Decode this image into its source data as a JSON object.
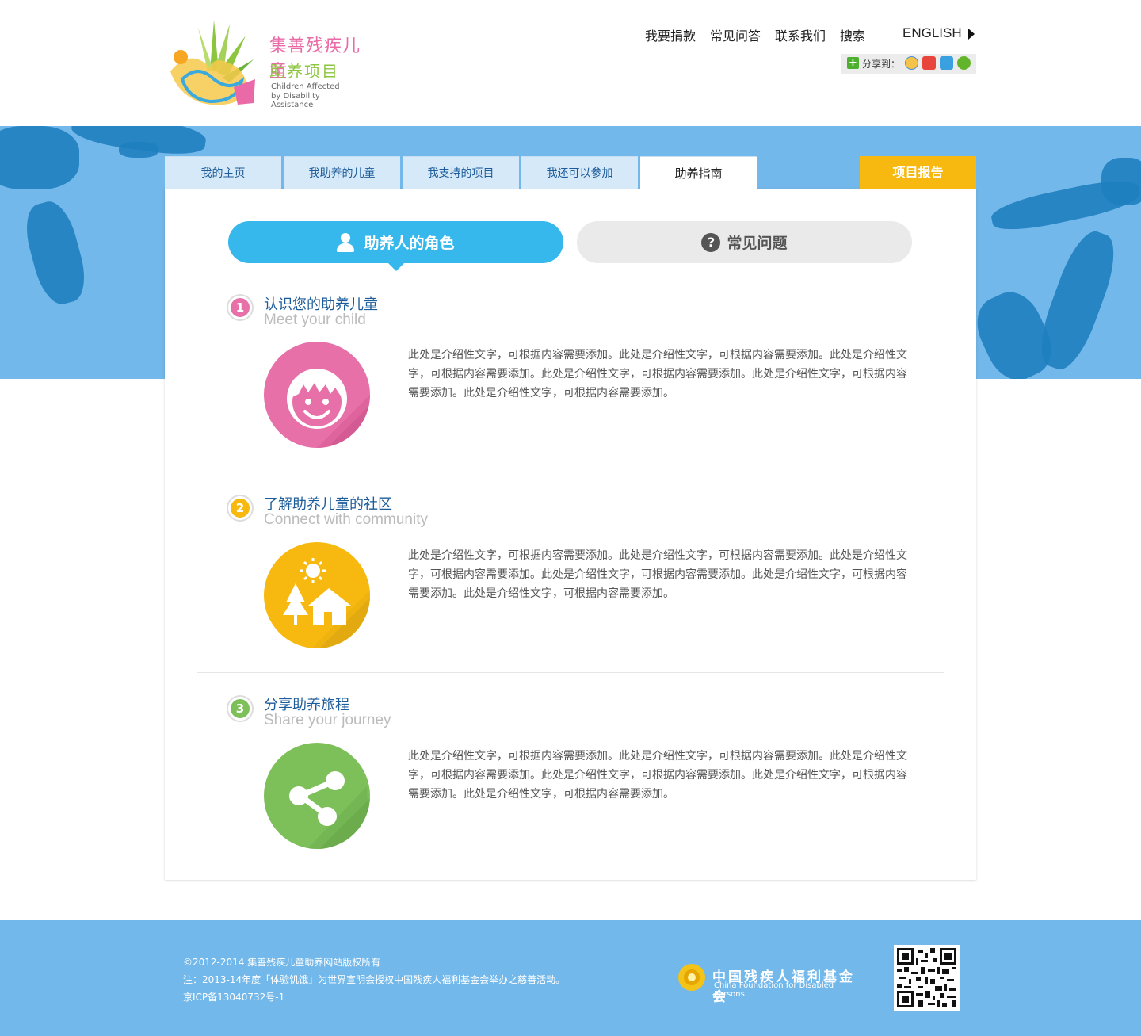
{
  "logo": {
    "cn_line1": "集善残疾儿童",
    "cn_line2": "助养项目",
    "en_line1": "Children Affected",
    "en_line2": "by Disability Assistance"
  },
  "topnav": {
    "items": [
      "我要捐款",
      "常见问答",
      "联系我们",
      "搜索"
    ],
    "english": "ENGLISH"
  },
  "share": {
    "label": "分享到：",
    "icons": [
      "qzone-icon",
      "weibo-icon",
      "tencent-weibo-icon",
      "wechat-icon"
    ]
  },
  "tabs": {
    "items": [
      "我的主页",
      "我助养的儿童",
      "我支持的项目",
      "我还可以参加",
      "助养指南"
    ],
    "active_index": 4,
    "report": "项目报告"
  },
  "pills": {
    "role": "助养人的角色",
    "faq": "常见问题"
  },
  "sections": [
    {
      "number": "1",
      "title": "认识您的助养儿童",
      "subtitle": "Meet your child",
      "icon": "child-face-icon",
      "color": "#e870a8",
      "text": "此处是介绍性文字，可根据内容需要添加。此处是介绍性文字，可根据内容需要添加。此处是介绍性文字，可根据内容需要添加。此处是介绍性文字，可根据内容需要添加。此处是介绍性文字，可根据内容需要添加。此处是介绍性文字，可根据内容需要添加。"
    },
    {
      "number": "2",
      "title": "了解助养儿童的社区",
      "subtitle": "Connect with community",
      "icon": "house-icon",
      "color": "#f7b90f",
      "text": "此处是介绍性文字，可根据内容需要添加。此处是介绍性文字，可根据内容需要添加。此处是介绍性文字，可根据内容需要添加。此处是介绍性文字，可根据内容需要添加。此处是介绍性文字，可根据内容需要添加。此处是介绍性文字，可根据内容需要添加。"
    },
    {
      "number": "3",
      "title": "分享助养旅程",
      "subtitle": "Share your journey",
      "icon": "share-icon",
      "color": "#7dc05a",
      "text": "此处是介绍性文字，可根据内容需要添加。此处是介绍性文字，可根据内容需要添加。此处是介绍性文字，可根据内容需要添加。此处是介绍性文字，可根据内容需要添加。此处是介绍性文字，可根据内容需要添加。此处是介绍性文字，可根据内容需要添加。"
    }
  ],
  "footer": {
    "copyright": "©2012-2014 集善残疾儿童助养网站版权所有",
    "note": "注：2013-14年度「体验饥饿」为世界宣明会授权中国残疾人福利基金会举办之慈善活动。",
    "icp": "京ICP备13040732号-1",
    "org_cn": "中国残疾人福利基金会",
    "org_en": "China Foundation for Disabled Persons"
  },
  "colors": {
    "band": "#73b8ea",
    "accent_blue": "#37b8ec",
    "report_yellow": "#f7b90f",
    "pink": "#e870a8",
    "green": "#7dc05a"
  }
}
